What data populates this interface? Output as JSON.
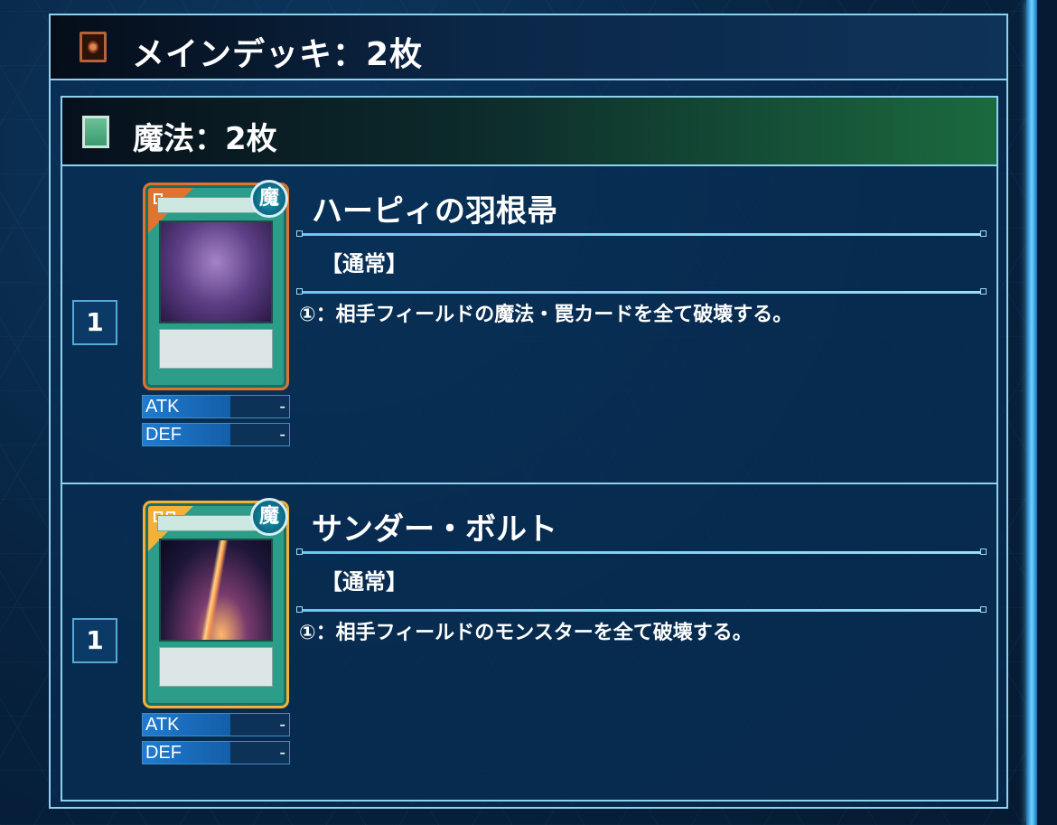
{
  "main_deck": {
    "title": "メインデッキ：2枚",
    "icon": "card-back-icon"
  },
  "section": {
    "title": "魔法：2枚",
    "icon": "spell-square-icon",
    "accent_color": "#1b6a3f"
  },
  "cards": [
    {
      "count": "1",
      "name": "ハーピィの羽根帚",
      "type": "【通常】",
      "effect": "①：相手フィールドの魔法・罠カードを全て破壊する。",
      "attribute": "魔",
      "rarity_color": "#e0742e",
      "atk_label": "ATK",
      "atk_value": "-",
      "def_label": "DEF",
      "def_value": "-",
      "image": "feather-broom-art"
    },
    {
      "count": "1",
      "name": "サンダー・ボルト",
      "type": "【通常】",
      "effect": "①：相手フィールドのモンスターを全て破壊する。",
      "attribute": "魔",
      "rarity_color": "#f3b13a",
      "atk_label": "ATK",
      "atk_value": "-",
      "def_label": "DEF",
      "def_value": "-",
      "image": "lightning-art"
    }
  ]
}
